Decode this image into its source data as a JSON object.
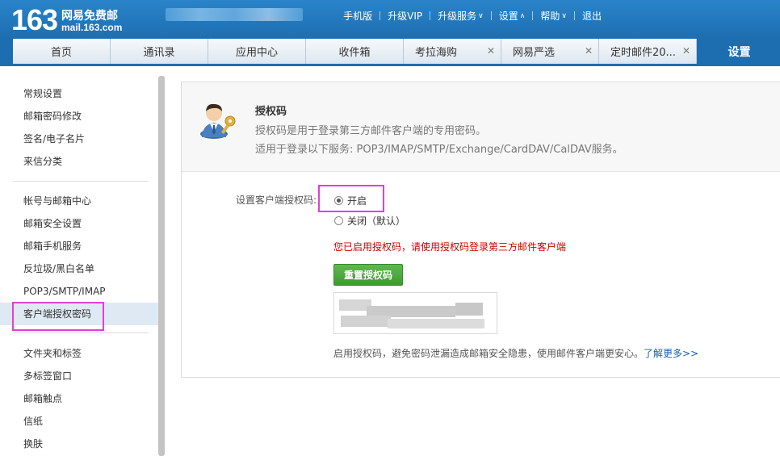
{
  "header": {
    "logo_num": "163",
    "logo_cn": "网易免费邮",
    "logo_domain": "mail.163.com",
    "nav": [
      {
        "label": "手机版",
        "caret": ""
      },
      {
        "label": "升级VIP",
        "caret": ""
      },
      {
        "label": "升级服务",
        "caret": "∨"
      },
      {
        "label": "设置",
        "caret": "∧"
      },
      {
        "label": "帮助",
        "caret": "∨"
      },
      {
        "label": "退出",
        "caret": ""
      }
    ]
  },
  "tabs": [
    {
      "label": "首页",
      "closable": false
    },
    {
      "label": "通讯录",
      "closable": false
    },
    {
      "label": "应用中心",
      "closable": false
    },
    {
      "label": "收件箱",
      "closable": false
    },
    {
      "label": "考拉海购",
      "closable": true
    },
    {
      "label": "网易严选",
      "closable": true
    },
    {
      "label": "定时邮件20...",
      "closable": true
    },
    {
      "label": "设置",
      "closable": false,
      "active": true
    }
  ],
  "sidebar": {
    "group1": [
      "常规设置",
      "邮箱密码修改",
      "签名/电子名片",
      "来信分类"
    ],
    "group2": [
      "帐号与邮箱中心",
      "邮箱安全设置",
      "邮箱手机服务",
      "反垃圾/黑白名单",
      "POP3/SMTP/IMAP",
      "客户端授权密码"
    ],
    "group3": [
      "文件夹和标签",
      "多标签窗口",
      "邮箱触点",
      "信纸",
      "换肤"
    ],
    "active": "客户端授权密码"
  },
  "panel": {
    "title": "授权码",
    "desc1": "授权码是用于登录第三方邮件客户端的专用密码。",
    "desc2": "适用于登录以下服务: POP3/IMAP/SMTP/Exchange/CardDAV/CalDAV服务。",
    "form_label": "设置客户端授权码:",
    "option_on": "开启",
    "option_off": "关闭（默认）",
    "selected": "开启",
    "warning": "您已启用授权码，请使用授权码登录第三方邮件客户端",
    "reset_button": "重置授权码",
    "foot_note": "启用授权码，避免密码泄漏造成邮箱安全隐患，使用邮件客户端更安心。",
    "foot_link": "了解更多>>"
  },
  "colors": {
    "brand_blue": "#1d6eb0",
    "highlight": "#e23fd4",
    "warning": "#cc0000",
    "button_green": "#4aa83b"
  }
}
